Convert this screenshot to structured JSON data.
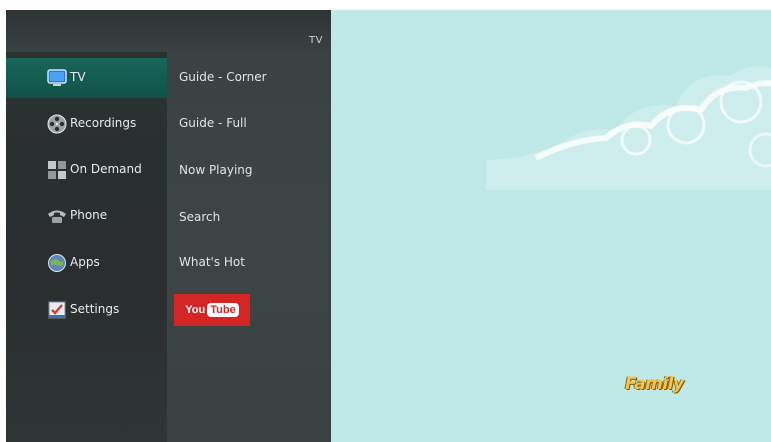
{
  "menu": {
    "title": "TV",
    "main_items": [
      {
        "label": "TV",
        "icon": "tv-icon",
        "selected": true
      },
      {
        "label": "Recordings",
        "icon": "film-reel-icon"
      },
      {
        "label": "On Demand",
        "icon": "on-demand-grid-icon"
      },
      {
        "label": "Phone",
        "icon": "phone-icon"
      },
      {
        "label": "Apps",
        "icon": "apps-globe-icon"
      },
      {
        "label": "Settings",
        "icon": "settings-checklist-icon"
      }
    ],
    "sub_items": [
      {
        "label": "Guide - Corner"
      },
      {
        "label": "Guide - Full"
      },
      {
        "label": "Now Playing"
      },
      {
        "label": "Search"
      },
      {
        "label": "What's Hot"
      }
    ],
    "youtube": {
      "you": "You",
      "tube": "Tube"
    }
  },
  "preview": {
    "channel_logo": "Family",
    "colors": {
      "background": "#bfe9e6",
      "selected": "#19665a",
      "youtube": "#d42525"
    }
  }
}
